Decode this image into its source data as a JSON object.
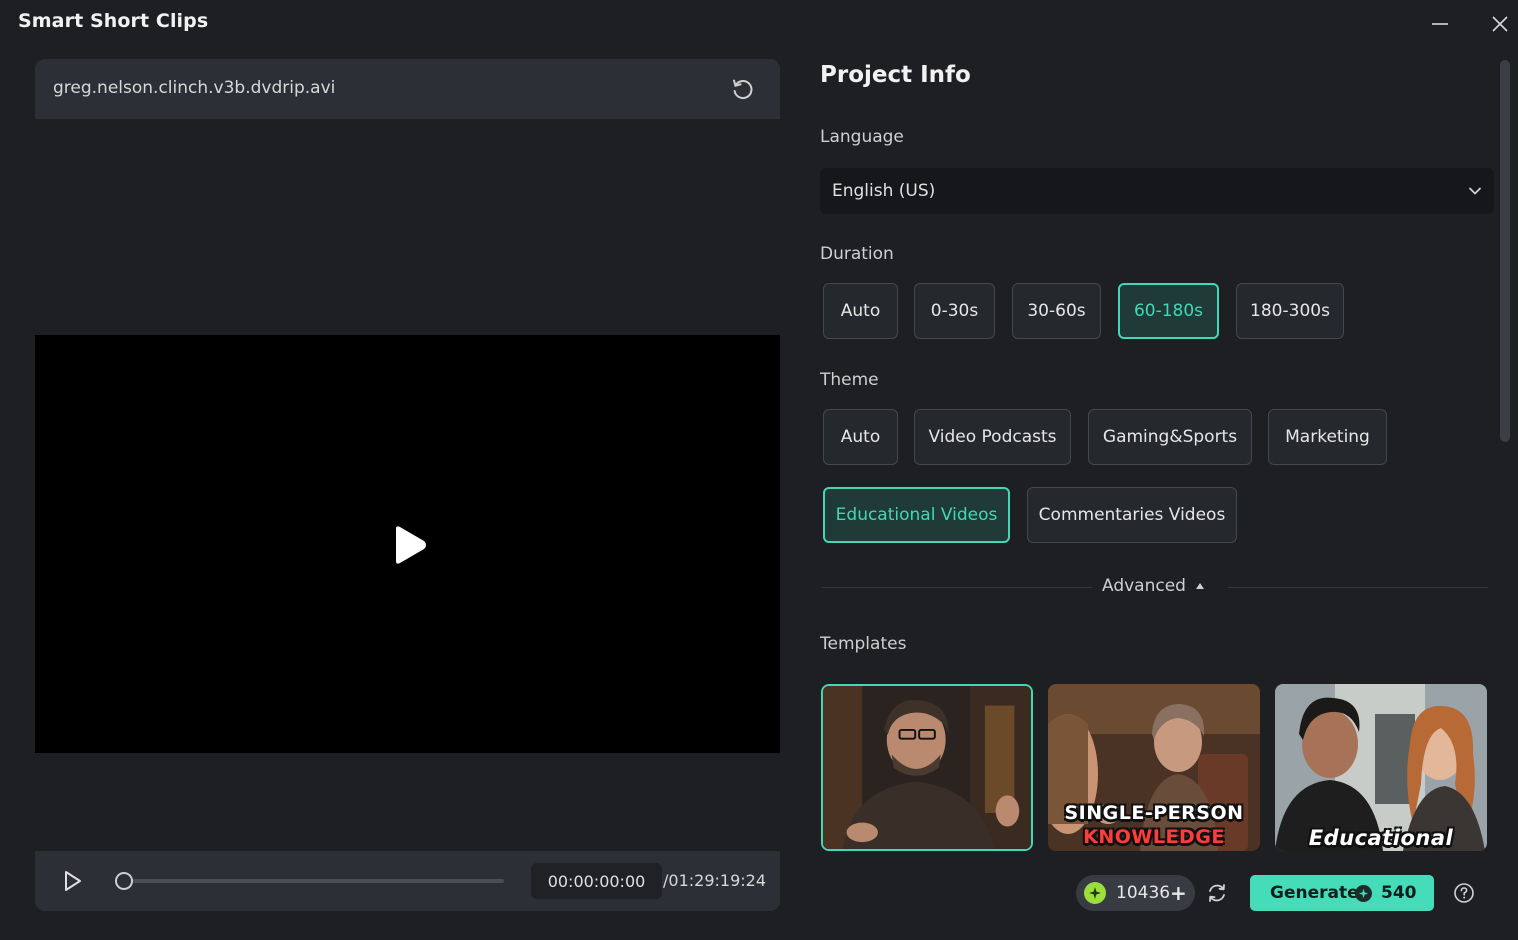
{
  "window": {
    "title": "Smart Short Clips",
    "minimize_icon": "minimize-icon",
    "close_icon": "close-icon"
  },
  "preview": {
    "file_name": "greg.nelson.clinch.v3b.dvdrip.avi",
    "refresh_icon": "refresh-icon",
    "current_time": "00:00:00:00",
    "total_time": "/01:29:19:24",
    "progress": 0
  },
  "project": {
    "title": "Project Info",
    "language_label": "Language",
    "language_value": "English (US)",
    "duration_label": "Duration",
    "duration_options": [
      "Auto",
      "0-30s",
      "30-60s",
      "60-180s",
      "180-300s"
    ],
    "duration_selected": "60-180s",
    "theme_label": "Theme",
    "theme_options": [
      "Auto",
      "Video Podcasts",
      "Gaming&Sports",
      "Marketing",
      "Educational Videos",
      "Commentaries Videos"
    ],
    "theme_selected": "Educational Videos",
    "advanced_label": "Advanced",
    "templates_label": "Templates",
    "templates": [
      {
        "caption": "",
        "selected": true
      },
      {
        "caption_line1": "SINGLE-PERSON",
        "caption_line2": "KNOWLEDGE",
        "selected": false
      },
      {
        "caption": "Educational",
        "selected": false
      }
    ]
  },
  "footer": {
    "credits": "10436",
    "generate_label": "Generate",
    "generate_cost": "540"
  },
  "colors": {
    "accent": "#41d8b8",
    "generate_bg": "#45dcb9",
    "coin": "#9bdf3e"
  }
}
